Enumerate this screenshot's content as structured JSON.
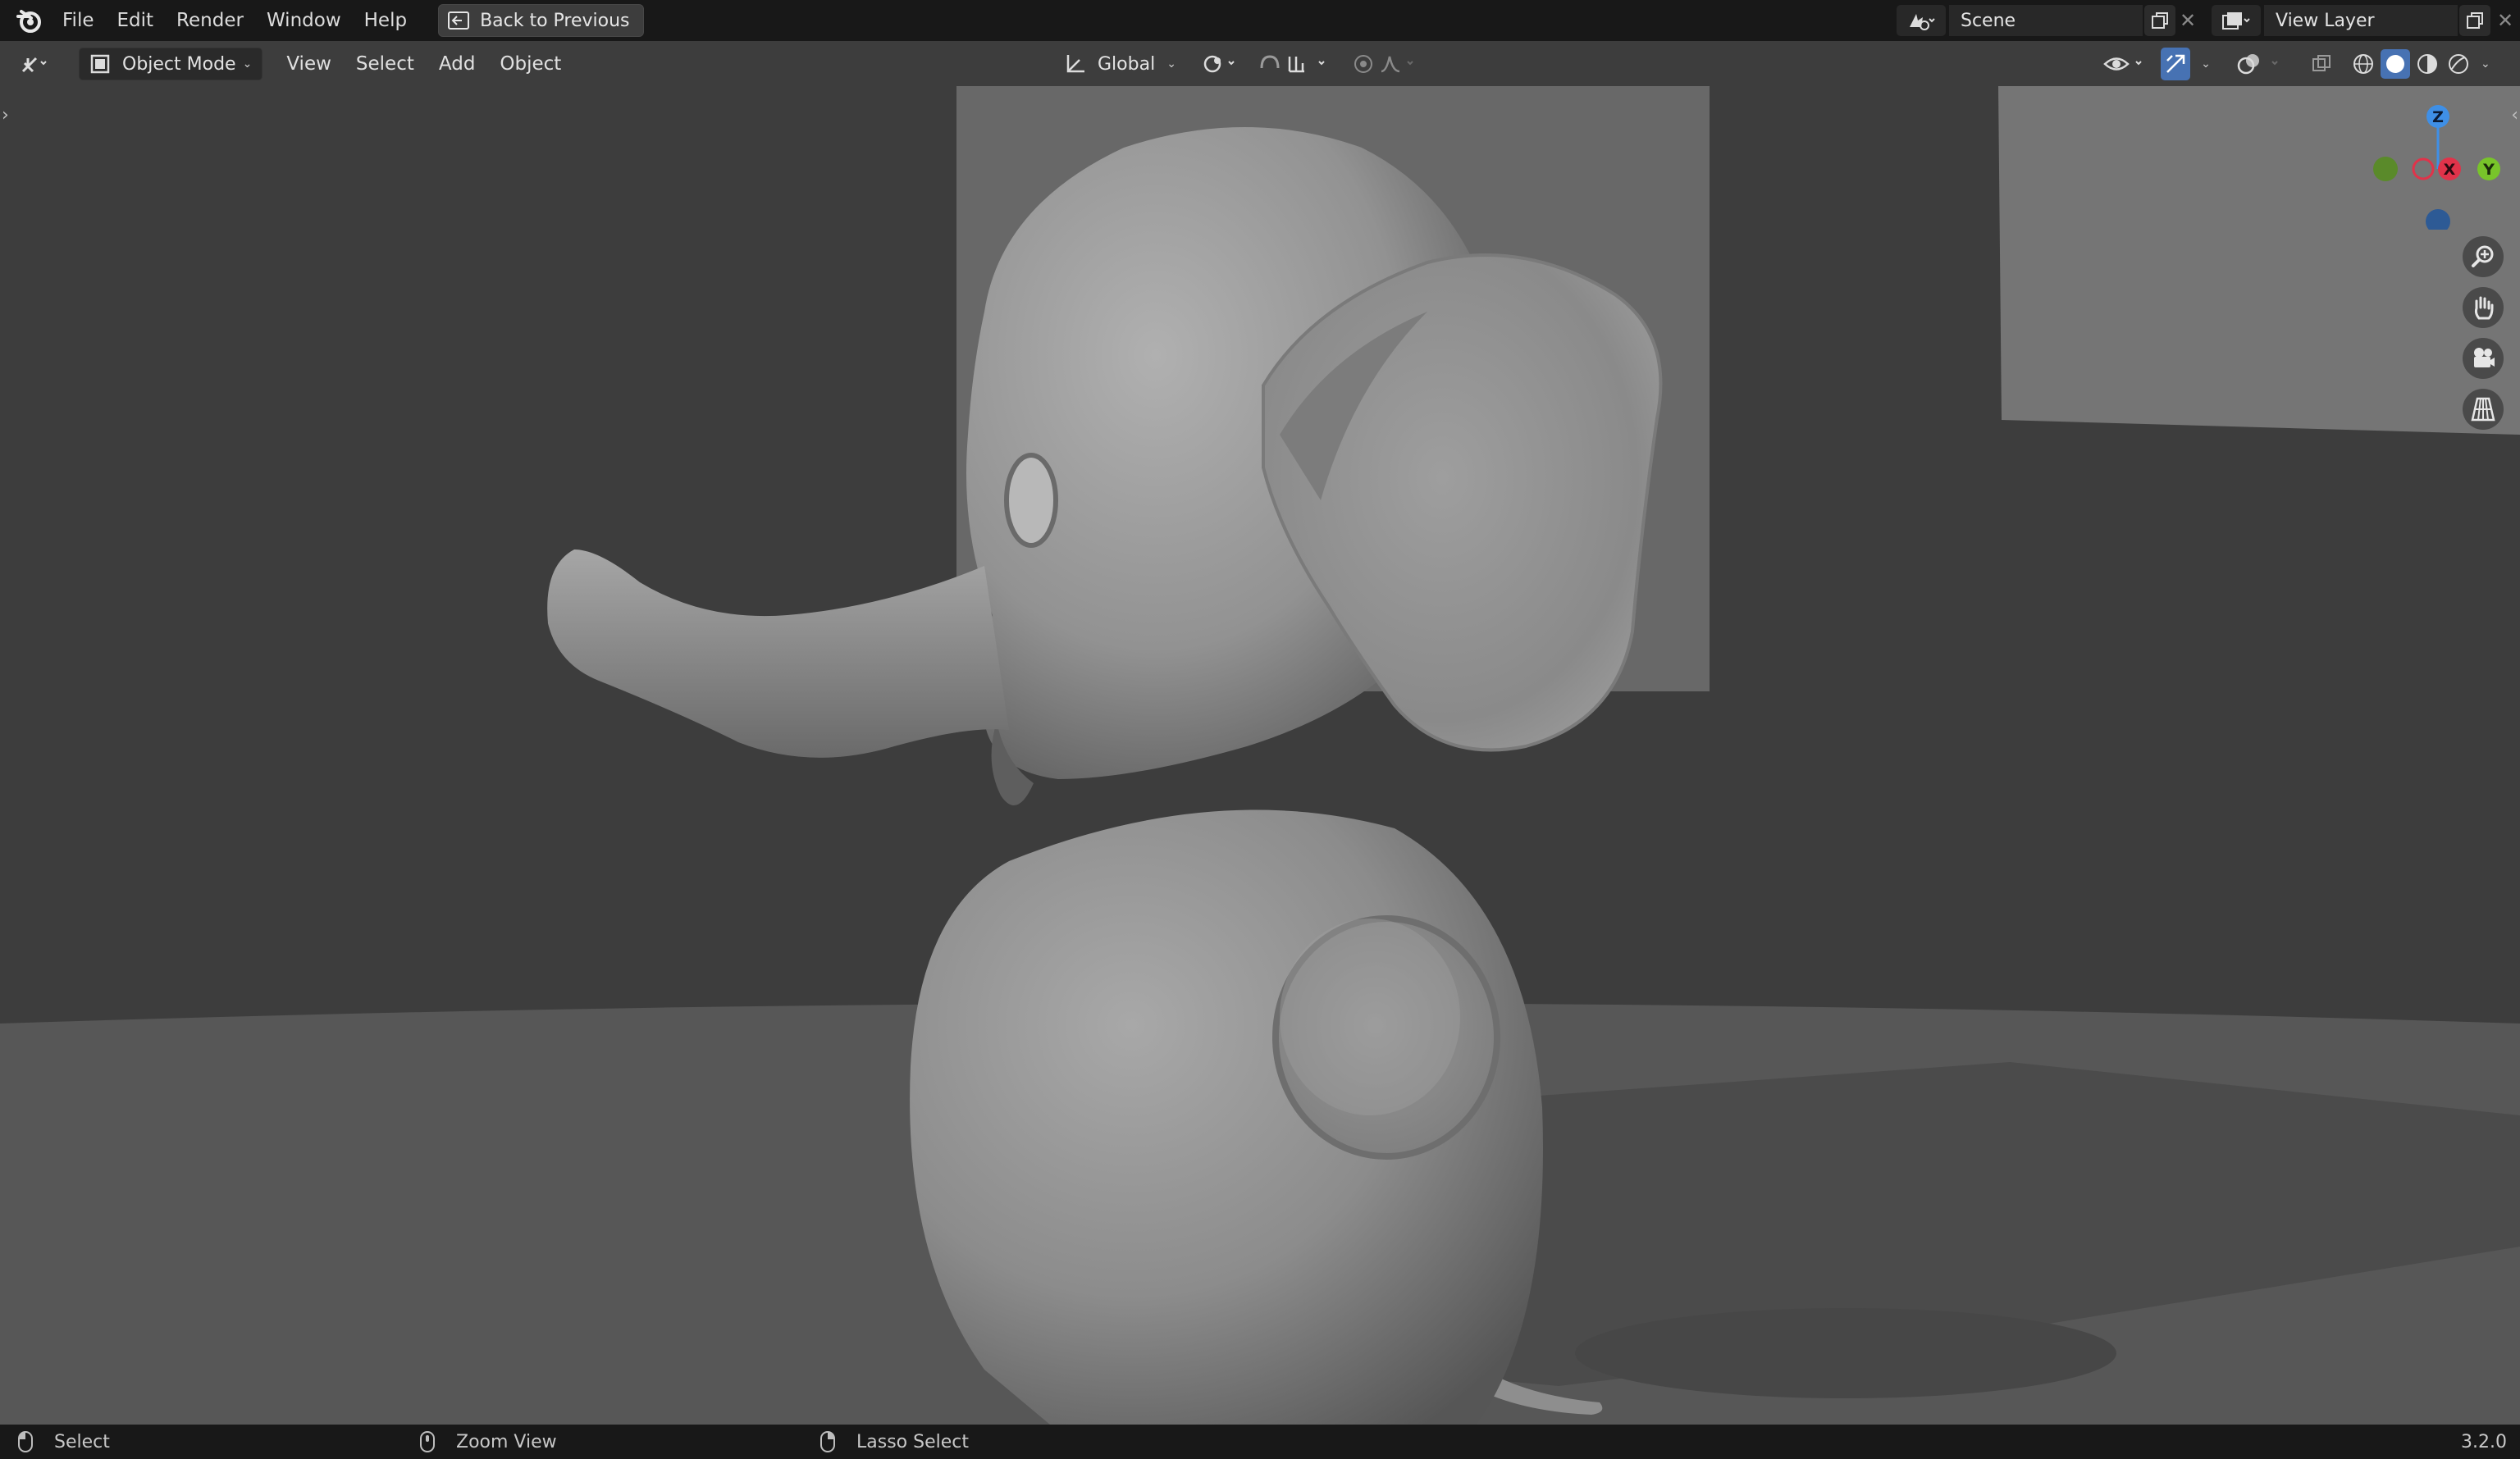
{
  "menubar": {
    "items": [
      "File",
      "Edit",
      "Render",
      "Window",
      "Help"
    ],
    "back_button": "Back to Previous",
    "scene_name": "Scene",
    "view_layer": "View Layer"
  },
  "viewport_header": {
    "mode": "Object Mode",
    "menus": [
      "View",
      "Select",
      "Add",
      "Object"
    ],
    "transform_orientation": "Global"
  },
  "gizmo": {
    "axis_z": "Z",
    "axis_x": "X",
    "axis_y": "Y",
    "colors": {
      "x": "#e0334a",
      "y": "#78c42a",
      "z": "#3f8fe6",
      "neg_y": "#5a8a2a",
      "neg_z": "#2d5a95"
    }
  },
  "statusbar": {
    "left": "Select",
    "middle": "Zoom View",
    "right": "Lasso Select",
    "version": "3.2.0"
  },
  "icons": [
    "blender-logo",
    "back-icon",
    "scene-icon",
    "view-layer-icon",
    "editor-type-icon",
    "object-mode-icon",
    "transform-orientation-icon",
    "pivot-icon",
    "snap-icon",
    "proportional-edit-icon",
    "falloff-icon",
    "visibility-icon",
    "gizmo-icon",
    "overlay-icon",
    "xray-icon",
    "wireframe-shading-icon",
    "solid-shading-icon",
    "material-shading-icon",
    "rendered-shading-icon",
    "zoom-icon",
    "hand-icon",
    "camera-icon",
    "grid-icon",
    "mouse-left-icon",
    "mouse-middle-icon",
    "mouse-right-icon"
  ]
}
